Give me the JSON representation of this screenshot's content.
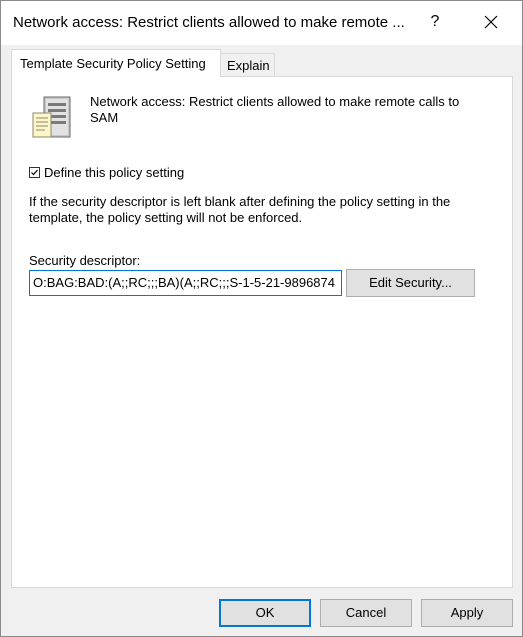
{
  "window": {
    "title": "Network access: Restrict clients allowed to make remote ...",
    "help_label": "?"
  },
  "tabs": [
    {
      "label": "Template Security Policy Setting",
      "active": true
    },
    {
      "label": "Explain",
      "active": false
    }
  ],
  "policy": {
    "name": "Network access: Restrict clients allowed to make remote calls to SAM",
    "icon": "server-icon",
    "define_label": "Define this policy setting",
    "define_checked": true,
    "info": "If the security descriptor is left blank after defining the policy setting in the template, the policy setting will not be enforced.",
    "sd_label": "Security descriptor:",
    "sd_value": "O:BAG:BAD:(A;;RC;;;BA)(A;;RC;;;S-1-5-21-9896874",
    "edit_button": "Edit Security..."
  },
  "footer": {
    "ok": "OK",
    "cancel": "Cancel",
    "apply": "Apply"
  },
  "colors": {
    "accent": "#0078d7",
    "button_face": "#e1e1e1",
    "dialog_bg": "#f0f0f0"
  }
}
